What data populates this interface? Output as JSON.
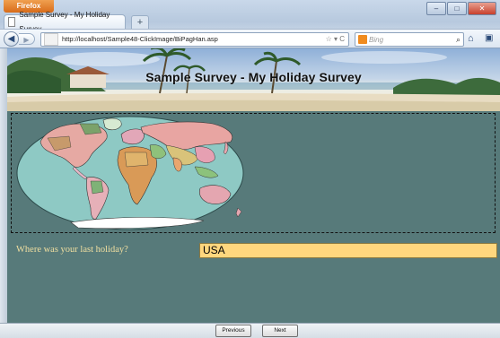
{
  "browser": {
    "app_button": "Firefox",
    "tab_title": "Sample Survey - My Holiday Survey",
    "address": "http://localhost/Sample48-ClickImage/BiPagHan.asp",
    "address_tools": "☆ ▾ C",
    "search_placeholder": "Bing",
    "icons": [
      "back-arrow-icon",
      "forward-arrow-icon",
      "search-icon",
      "home-icon",
      "bookmark-icon",
      "minimize-icon",
      "maximize-icon",
      "close-icon"
    ]
  },
  "survey": {
    "title": "Sample Survey - My Holiday Survey",
    "question": "Where was your last holiday?",
    "answer": "USA"
  },
  "footer": {
    "previous_label": "Previous",
    "next_label": "Next"
  },
  "colors": {
    "content_bg": "#577a7a",
    "answer_bg": "#ffd77e",
    "question_text": "#f1dfa0",
    "map_ocean": "#8ec9c4"
  }
}
